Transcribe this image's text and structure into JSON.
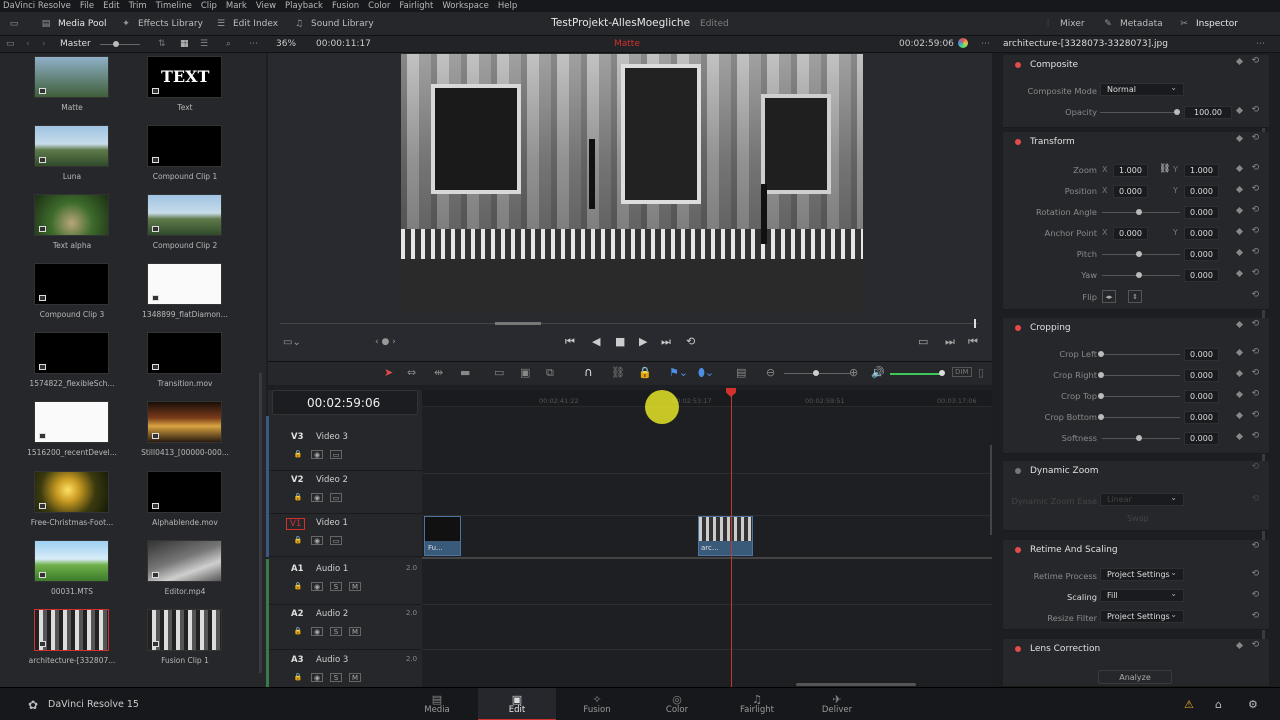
{
  "menubar": [
    "DaVinci Resolve",
    "File",
    "Edit",
    "Trim",
    "Timeline",
    "Clip",
    "Mark",
    "View",
    "Playback",
    "Fusion",
    "Color",
    "Fairlight",
    "Workspace",
    "Help"
  ],
  "toolbar": {
    "media_pool": "Media Pool",
    "effects": "Effects Library",
    "edit_index": "Edit Index",
    "sound_library": "Sound Library",
    "mixer": "Mixer",
    "metadata": "Metadata",
    "inspector": "Inspector"
  },
  "project": {
    "title": "TestProjekt-AllesMoegliche",
    "status": "Edited"
  },
  "subbar": {
    "bin": "Master",
    "zoom": "36%",
    "timecode_in": "00:00:11:17",
    "clip": "Matte",
    "timecode_out": "00:02:59:06",
    "filename": "architecture-[3328073-3328073].jpg"
  },
  "pool": [
    {
      "label": "Matte",
      "kind": "matte"
    },
    {
      "label": "Text",
      "kind": "text",
      "overlay": "TEXT"
    },
    {
      "label": "Luna",
      "kind": "bridge"
    },
    {
      "label": "Compound Clip 1",
      "kind": "black"
    },
    {
      "label": "Text alpha",
      "kind": "forest"
    },
    {
      "label": "Compound Clip 2",
      "kind": "bridge"
    },
    {
      "label": "Compound Clip 3",
      "kind": "black"
    },
    {
      "label": "1348899_flatDiamon...",
      "kind": "white"
    },
    {
      "label": "1574822_flexibleSch...",
      "kind": "black"
    },
    {
      "label": "Transition.mov",
      "kind": "black"
    },
    {
      "label": "1516200_recentDevel...",
      "kind": "white"
    },
    {
      "label": "Still0413_[00000-000...",
      "kind": "xmas"
    },
    {
      "label": "Free-Christmas-Foot...",
      "kind": "bokeh"
    },
    {
      "label": "Alphablende.mov",
      "kind": "black"
    },
    {
      "label": "00031.MTS",
      "kind": "sky"
    },
    {
      "label": "Editor.mp4",
      "kind": "fog"
    },
    {
      "label": "architecture-[332807...",
      "kind": "arch",
      "selected": true
    },
    {
      "label": "Fusion Clip 1",
      "kind": "arch"
    }
  ],
  "timeline": {
    "timecode": "00:02:59:06",
    "ruler": [
      "00:02:41:22",
      "00:02:53:17",
      "00:02:59:51",
      "00:03:17:06"
    ],
    "tracks": [
      {
        "id": "V3",
        "name": "Video 3"
      },
      {
        "id": "V2",
        "name": "Video 2"
      },
      {
        "id": "V1",
        "name": "Video 1"
      },
      {
        "id": "A1",
        "name": "Audio 1",
        "ch": "2.0"
      },
      {
        "id": "A2",
        "name": "Audio 2",
        "ch": "2.0"
      },
      {
        "id": "A3",
        "name": "Audio 3",
        "ch": "2.0"
      }
    ],
    "clips": [
      {
        "label": "Fu..."
      },
      {
        "label": "arc..."
      }
    ]
  },
  "inspector": {
    "composite": {
      "title": "Composite",
      "mode_label": "Composite Mode",
      "mode": "Normal",
      "opacity_label": "Opacity",
      "opacity": "100.00"
    },
    "transform": {
      "title": "Transform",
      "zoom_label": "Zoom",
      "zoom_x": "1.000",
      "zoom_y": "1.000",
      "position_label": "Position",
      "pos_x": "0.000",
      "pos_y": "0.000",
      "rotation_label": "Rotation Angle",
      "rotation": "0.000",
      "anchor_label": "Anchor Point",
      "anchor_x": "0.000",
      "anchor_y": "0.000",
      "pitch_label": "Pitch",
      "pitch": "0.000",
      "yaw_label": "Yaw",
      "yaw": "0.000",
      "flip_label": "Flip",
      "x": "X",
      "y": "Y"
    },
    "cropping": {
      "title": "Cropping",
      "left_label": "Crop Left",
      "left": "0.000",
      "right_label": "Crop Right",
      "right": "0.000",
      "top_label": "Crop Top",
      "top": "0.000",
      "bottom_label": "Crop Bottom",
      "bottom": "0.000",
      "soft_label": "Softness",
      "soft": "0.000"
    },
    "dynamic": {
      "title": "Dynamic Zoom",
      "ease_label": "Dynamic Zoom Ease",
      "ease": "Linear",
      "swap": "Swap"
    },
    "retime": {
      "title": "Retime And Scaling",
      "process_label": "Retime Process",
      "process": "Project Settings",
      "scaling_label": "Scaling",
      "scaling": "Fill",
      "filter_label": "Resize Filter",
      "filter": "Project Settings"
    },
    "lens": {
      "title": "Lens Correction",
      "analyze": "Analyze"
    }
  },
  "pages": [
    "Media",
    "Edit",
    "Fusion",
    "Color",
    "Fairlight",
    "Deliver"
  ],
  "app_version": "DaVinci Resolve 15"
}
